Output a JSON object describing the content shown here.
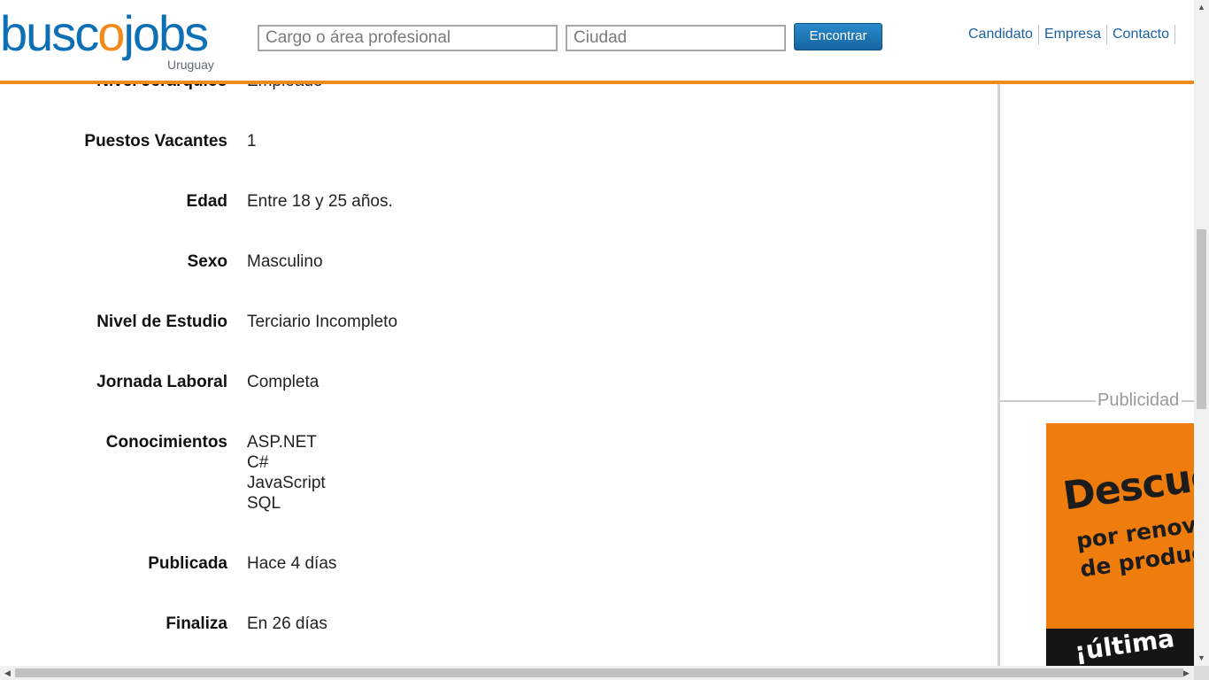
{
  "header": {
    "logo": {
      "word_start": "busc",
      "word_accent": "o",
      "word_end": "jobs",
      "region": "Uruguay"
    },
    "search": {
      "cargo_placeholder": "Cargo o área profesional",
      "ciudad_placeholder": "Ciudad",
      "button_label": "Encontrar"
    },
    "nav": [
      {
        "label": "Candidato"
      },
      {
        "label": "Empresa"
      },
      {
        "label": "Contacto"
      }
    ],
    "nav_overflow_glyph": " ",
    "accent_color": "#f28a1c",
    "brand_color": "#0d6fb4"
  },
  "details": [
    {
      "label": "Nivel Jerárquico",
      "value": "Empleado"
    },
    {
      "label": "Puestos Vacantes",
      "value": "1"
    },
    {
      "label": "Edad",
      "value": "Entre 18 y 25 años."
    },
    {
      "label": "Sexo",
      "value": "Masculino"
    },
    {
      "label": "Nivel de Estudio",
      "value": "Terciario Incompleto"
    },
    {
      "label": "Jornada Laboral",
      "value": "Completa"
    },
    {
      "label": "Conocimientos",
      "values": [
        "ASP.NET",
        "C#",
        "JavaScript",
        "SQL"
      ]
    },
    {
      "label": "Publicada",
      "value": "Hace 4 días"
    },
    {
      "label": "Finaliza",
      "value": "En 26 días"
    }
  ],
  "sidebar": {
    "ad_section_label": "Publicidad",
    "ad": {
      "headline": "Descuen",
      "line1": "por renovaci",
      "line2": "de producto",
      "bottom": "¡última"
    }
  },
  "scrollbars": {
    "up": "▲",
    "down": "▼",
    "left": "◀",
    "right": "▶"
  }
}
